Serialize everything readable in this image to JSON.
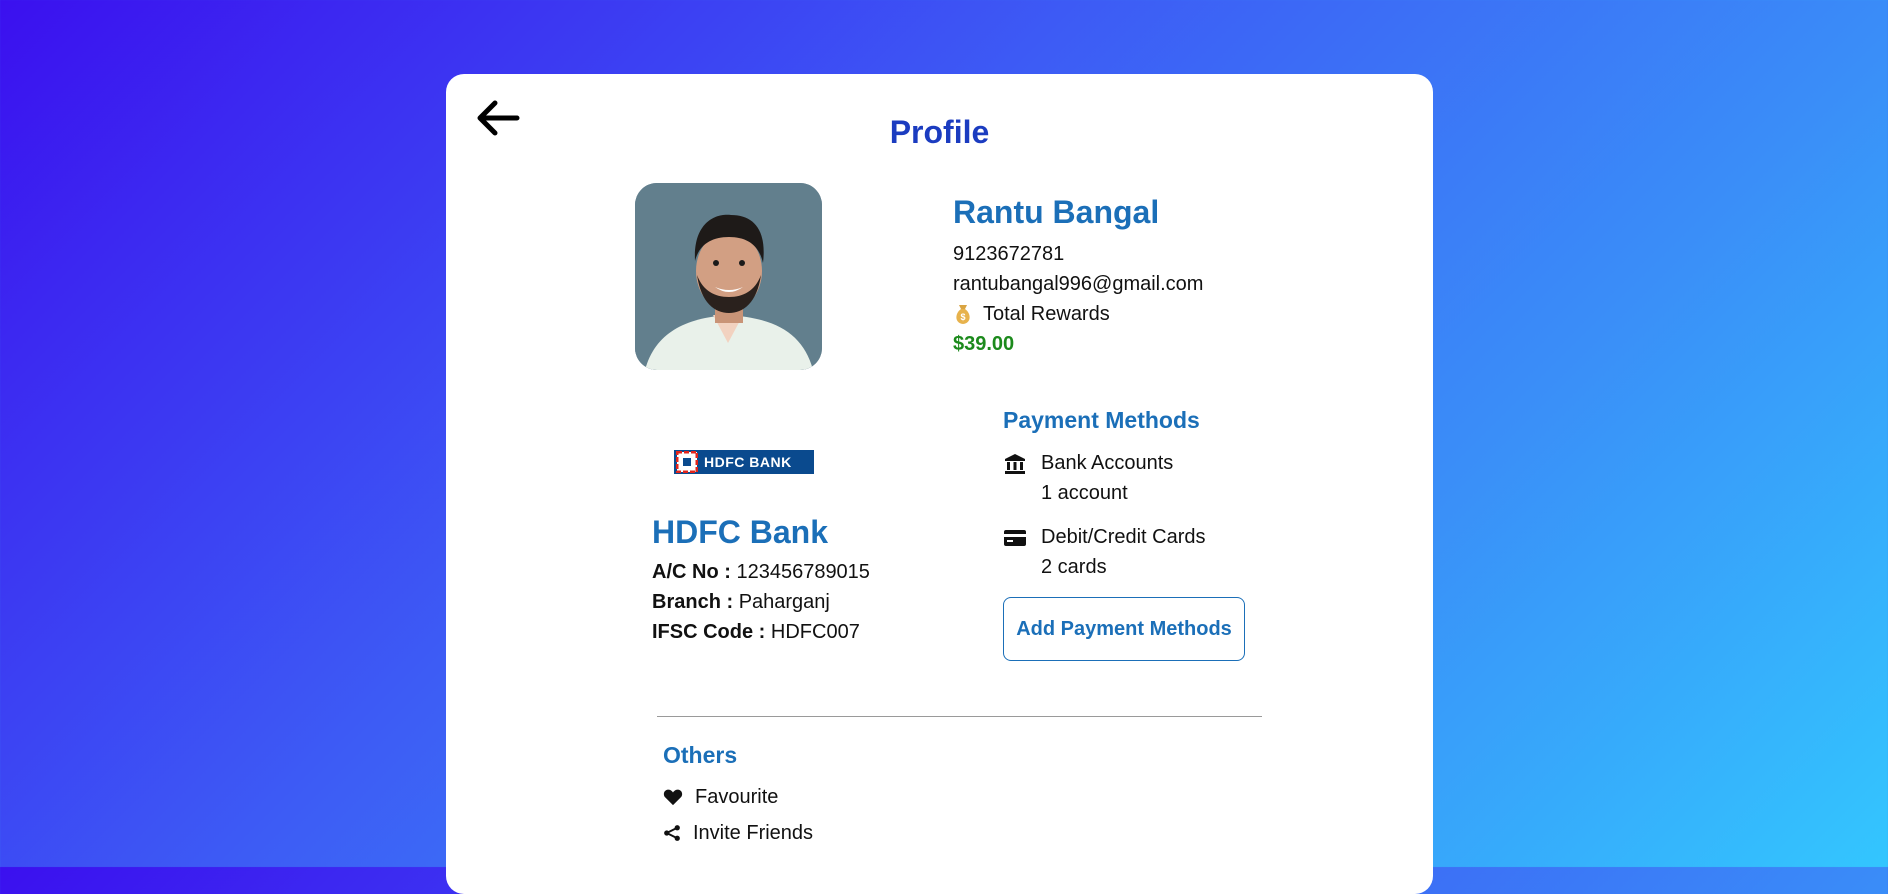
{
  "header": {
    "title": "Profile",
    "back_icon": "arrow-left-icon"
  },
  "profile": {
    "name": "Rantu Bangal",
    "phone": "9123672781",
    "email": "rantubangal996@gmail.com",
    "rewards_label": "Total Rewards",
    "rewards_amount": "$39.00",
    "rewards_icon": "money-bag-icon"
  },
  "bank": {
    "logo_text": "HDFC BANK",
    "name": "HDFC Bank",
    "account_label": "A/C No :",
    "account_value": "123456789015",
    "branch_label": "Branch :",
    "branch_value": "Paharganj",
    "ifsc_label": "IFSC Code :",
    "ifsc_value": "HDFC007"
  },
  "payment_methods": {
    "title": "Payment Methods",
    "items": [
      {
        "label": "Bank Accounts",
        "sub": "1 account",
        "icon": "bank-icon"
      },
      {
        "label": "Debit/Credit Cards",
        "sub": "2 cards",
        "icon": "credit-card-icon"
      }
    ],
    "add_button": "Add Payment Methods"
  },
  "others": {
    "title": "Others",
    "items": [
      {
        "label": "Favourite",
        "icon": "heart-icon"
      },
      {
        "label": "Invite Friends",
        "icon": "share-icon"
      }
    ]
  },
  "colors": {
    "accent": "#1b6fb8",
    "title": "#1b3cc0",
    "rewards": "#1c8a1c",
    "bank_brand": "#0a4a8e"
  }
}
